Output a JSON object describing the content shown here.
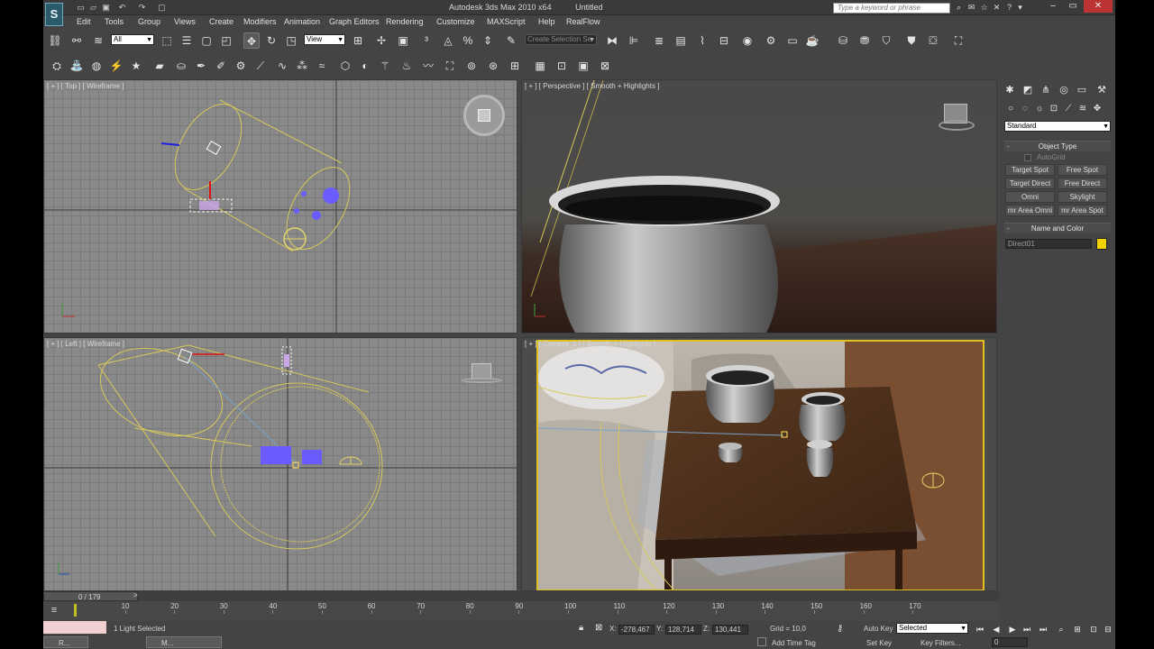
{
  "titlebar": {
    "app_title": "Autodesk 3ds Max 2010 x64",
    "doc_title": "Untitled",
    "search_placeholder": "Type a keyword or phrase",
    "logo_text": "S"
  },
  "menu": [
    "Edit",
    "Tools",
    "Group",
    "Views",
    "Create",
    "Modifiers",
    "Animation",
    "Graph Editors",
    "Rendering",
    "Customize",
    "MAXScript",
    "Help",
    "RealFlow"
  ],
  "main_toolbar": {
    "selection_filter": "All",
    "ref_coord": "View",
    "named_selection": "Create Selection Se"
  },
  "viewports": {
    "top_label": "[ + ] [ Top ] [ Wireframe ]",
    "perspective_label": "[ + ] [ Perspective ] [ Smooth + Highlights ]",
    "left_label": "[ + ] [ Left ] [ Wireframe ]",
    "camera_label": "[ + ] [ Camera_1 ] [ Smooth + Highlights ]"
  },
  "command_panel": {
    "category": "Standard",
    "object_type_title": "Object Type",
    "autogrid_label": "AutoGrid",
    "buttons": [
      "Target Spot",
      "Free Spot",
      "Target Direct",
      "Free Direct",
      "Omni",
      "Skylight",
      "mr Area Omni",
      "mr Area Spot"
    ],
    "name_color_title": "Name and Color",
    "object_name": "Direct01",
    "object_color": "#f2d400"
  },
  "timeline": {
    "frame_counter": "0 / 179",
    "ticks": [
      "10",
      "20",
      "30",
      "40",
      "50",
      "60",
      "70",
      "80",
      "90",
      "100",
      "110",
      "120",
      "130",
      "140",
      "150",
      "160",
      "170"
    ]
  },
  "status": {
    "selection_info": "1 Light Selected",
    "x_label": "X:",
    "x_value": "-278,467",
    "y_label": "Y:",
    "y_value": "128,714",
    "z_label": "Z:",
    "z_value": "130,441",
    "grid": "Grid = 10,0",
    "auto_key": "Auto Key",
    "key_mode": "Selected",
    "set_key": "Set Key",
    "key_filters": "Key Filters...",
    "frame_field": "0",
    "add_time_tag": "Add Time Tag"
  },
  "taskbar": {
    "item1": "R...",
    "item2": "M..."
  },
  "colors": {
    "wireframe": "#d6c85a",
    "light_blue": "#6a5cff",
    "camera_frame": "#e0c020"
  }
}
